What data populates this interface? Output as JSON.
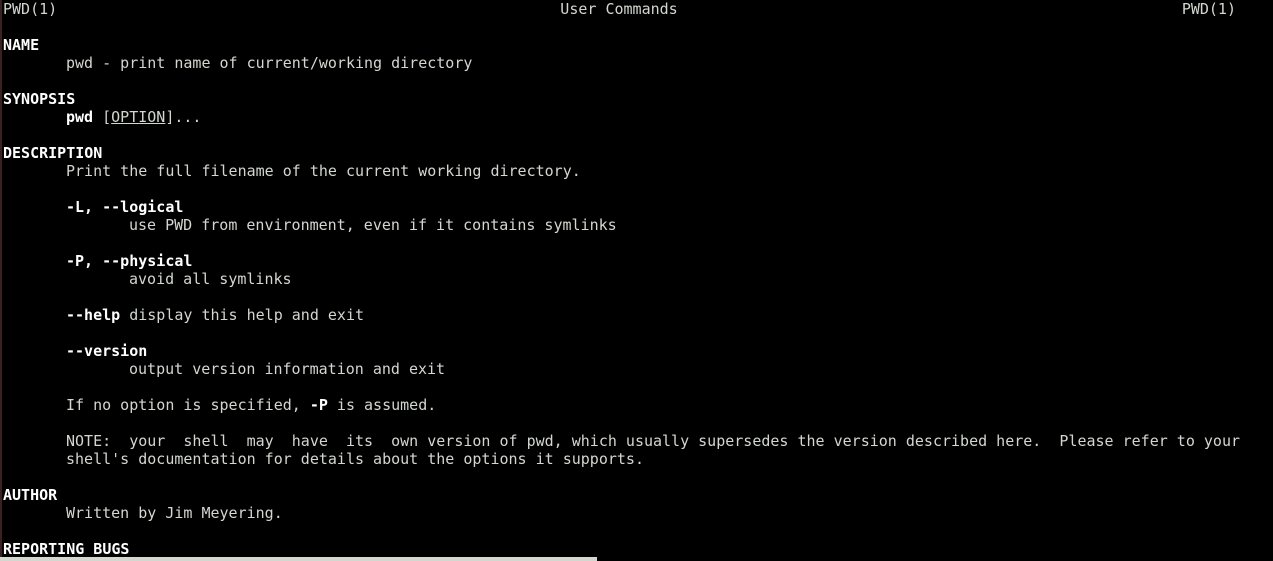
{
  "header": {
    "left": "PWD(1)",
    "center": "User Commands",
    "right": "PWD(1)"
  },
  "sections": {
    "name": {
      "heading": "NAME",
      "text": "pwd - print name of current/working directory"
    },
    "synopsis": {
      "heading": "SYNOPSIS",
      "command": "pwd",
      "space": " ",
      "bracket_open": "[",
      "option": "OPTION",
      "bracket_close": "]...",
      "full_line": "pwd [OPTION]..."
    },
    "description": {
      "heading": "DESCRIPTION",
      "intro": "Print the full filename of the current working directory.",
      "options": [
        {
          "flag": "-L, --logical",
          "desc": "use PWD from environment, even if it contains symlinks"
        },
        {
          "flag": "-P, --physical",
          "desc": "avoid all symlinks"
        },
        {
          "flag": "--help",
          "desc": " display this help and exit"
        },
        {
          "flag": "--version",
          "desc": "output version information and exit"
        }
      ],
      "default_note_pre": "If no option is specified, ",
      "default_note_flag": "-P",
      "default_note_post": " is assumed.",
      "note_line1": "NOTE:  your  shell  may  have  its  own version of pwd, which usually supersedes the version described here.  Please refer to your",
      "note_line2": "shell's documentation for details about the options it supports."
    },
    "author": {
      "heading": "AUTHOR",
      "text": "Written by Jim Meyering."
    },
    "reporting_bugs": {
      "heading": "REPORTING BUGS"
    }
  },
  "colors": {
    "background": "#000000",
    "text": "#d3d7cf",
    "bold": "#ffffff"
  }
}
